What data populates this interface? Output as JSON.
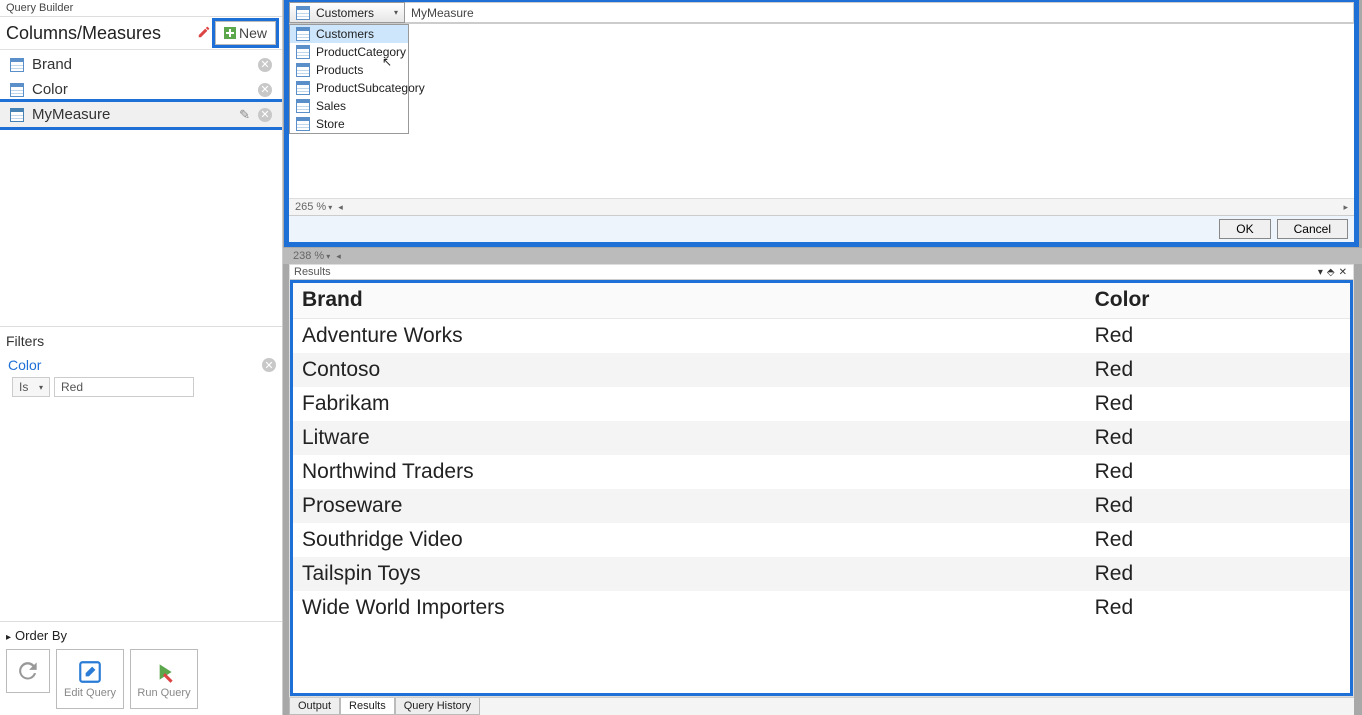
{
  "panelTitle": "Query Builder",
  "columnsHeading": "Columns/Measures",
  "newLabel": "New",
  "columns": [
    {
      "label": "Brand"
    },
    {
      "label": "Color"
    },
    {
      "label": "MyMeasure",
      "measure": true
    }
  ],
  "filtersTitle": "Filters",
  "filter": {
    "name": "Color",
    "op": "Is",
    "value": "Red"
  },
  "orderBy": "Order By",
  "refreshBtn": "",
  "editQueryBtn": "Edit Query",
  "runQueryBtn": "Run Query",
  "editor": {
    "selectedTable": "Customers",
    "expression": "MyMeasure",
    "zoom1": "265 %",
    "zoom2": "238 %",
    "ok": "OK",
    "cancel": "Cancel",
    "menu": [
      "Customers",
      "ProductCategory",
      "Products",
      "ProductSubcategory",
      "Sales",
      "Store"
    ]
  },
  "results": {
    "title": "Results",
    "headers": [
      "Brand",
      "Color"
    ],
    "rows": [
      [
        "Adventure Works",
        "Red"
      ],
      [
        "Contoso",
        "Red"
      ],
      [
        "Fabrikam",
        "Red"
      ],
      [
        "Litware",
        "Red"
      ],
      [
        "Northwind Traders",
        "Red"
      ],
      [
        "Proseware",
        "Red"
      ],
      [
        "Southridge Video",
        "Red"
      ],
      [
        "Tailspin Toys",
        "Red"
      ],
      [
        "Wide World Importers",
        "Red"
      ]
    ]
  },
  "tabs": [
    "Output",
    "Results",
    "Query History"
  ],
  "activeTab": "Results"
}
